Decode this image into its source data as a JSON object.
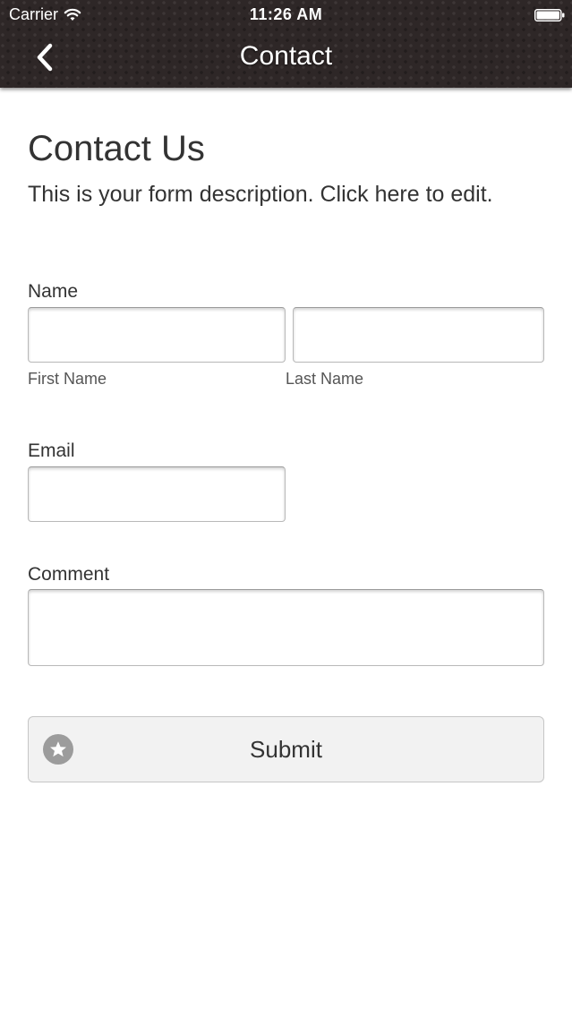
{
  "status_bar": {
    "carrier": "Carrier",
    "time": "11:26 AM",
    "wifi_icon": "wifi-icon",
    "battery_icon": "battery-icon"
  },
  "nav": {
    "title": "Contact",
    "back_icon": "chevron-left-icon"
  },
  "form": {
    "title": "Contact Us",
    "description": "This is your form description. Click here to edit.",
    "name": {
      "label": "Name",
      "first_label": "First Name",
      "last_label": "Last Name",
      "first_value": "",
      "last_value": ""
    },
    "email": {
      "label": "Email",
      "value": ""
    },
    "comment": {
      "label": "Comment",
      "value": ""
    },
    "submit": {
      "label": "Submit",
      "icon": "star-icon"
    }
  },
  "colors": {
    "header_background": "#2e2727",
    "header_text": "#ffffff",
    "body_text": "#333333",
    "button_background": "#f2f2f2",
    "submit_icon_background": "#9c9c9c"
  }
}
